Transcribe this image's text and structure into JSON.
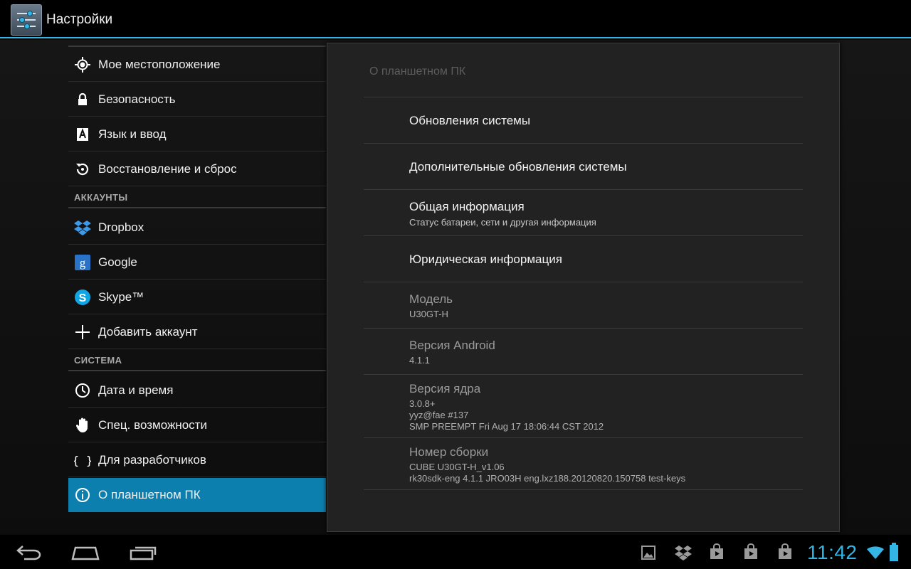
{
  "app": {
    "title": "Настройки"
  },
  "left": {
    "items": [
      {
        "label": "Мое местоположение",
        "icon": "location-icon"
      },
      {
        "label": "Безопасность",
        "icon": "lock-icon"
      },
      {
        "label": "Язык и ввод",
        "icon": "keyboard-language-icon"
      },
      {
        "label": "Восстановление и сброс",
        "icon": "backup-restore-icon"
      }
    ],
    "accounts_header": "АККАУНТЫ",
    "accounts": [
      {
        "label": "Dropbox",
        "icon": "dropbox-icon"
      },
      {
        "label": "Google",
        "icon": "google-icon"
      },
      {
        "label": "Skype™",
        "icon": "skype-icon"
      },
      {
        "label": "Добавить аккаунт",
        "icon": "plus-icon"
      }
    ],
    "system_header": "СИСТЕМА",
    "system": [
      {
        "label": "Дата и время",
        "icon": "clock-icon"
      },
      {
        "label": "Спец. возможности",
        "icon": "hand-icon"
      },
      {
        "label": "Для разработчиков",
        "icon": "braces-icon"
      },
      {
        "label": "О планшетном ПК",
        "icon": "info-icon",
        "selected": true
      }
    ]
  },
  "right": {
    "title": "О планшетном ПК",
    "system_updates": "Обновления системы",
    "additional_updates": "Дополнительные обновления системы",
    "general_info": {
      "title": "Общая информация",
      "summary": "Статус батареи, сети и другая информация"
    },
    "legal_info": "Юридическая информация",
    "model": {
      "title": "Модель",
      "value": "U30GT-H"
    },
    "android_version": {
      "title": "Версия Android",
      "value": "4.1.1"
    },
    "kernel_version": {
      "title": "Версия ядра",
      "line1": "3.0.8+",
      "line2": "yyz@fae #137",
      "line3": "SMP PREEMPT Fri Aug 17 18:06:44 CST 2012"
    },
    "build_number": {
      "title": "Номер сборки",
      "line1": "CUBE U30GT-H_v1.06",
      "line2": "rk30sdk-eng 4.1.1 JRO03H eng.lxz188.20120820.150758 test-keys"
    }
  },
  "statusbar": {
    "time": "11:42"
  },
  "colors": {
    "accent": "#33b5e5",
    "selected": "#0d7fae"
  }
}
